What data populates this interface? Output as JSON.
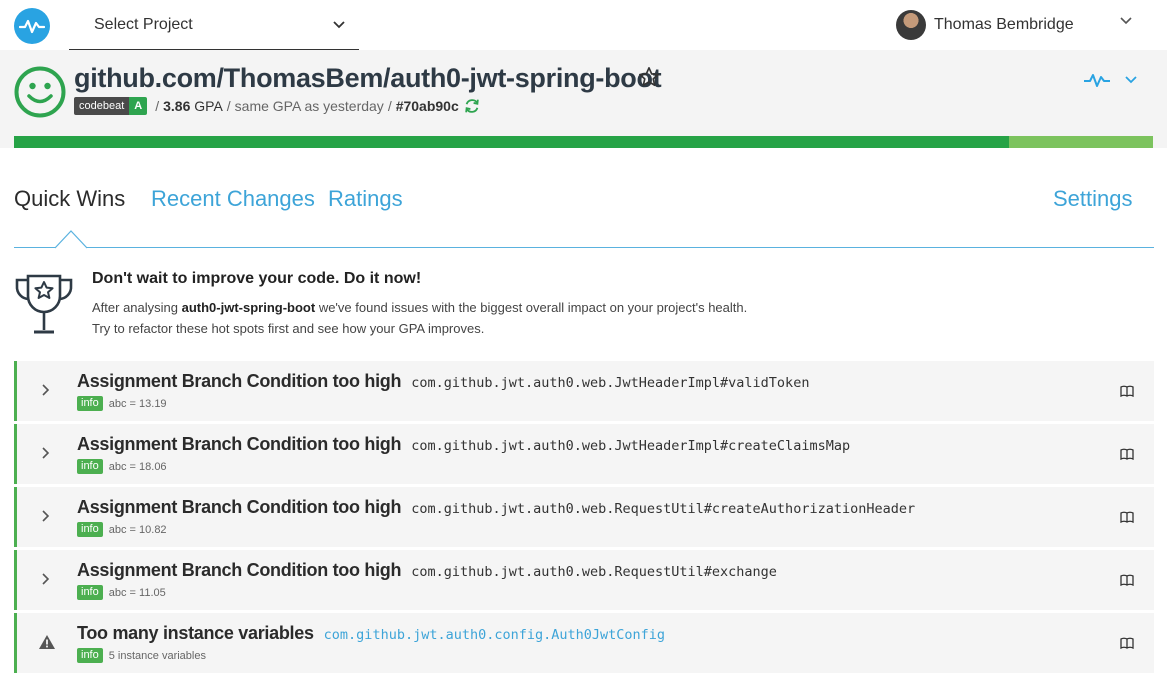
{
  "topbar": {
    "project_select_label": "Select Project",
    "user_name": "Thomas Bembridge"
  },
  "header": {
    "repo_title": "github.com/ThomasBem/auth0-jwt-spring-boot",
    "badge_label": "codebeat",
    "badge_grade": "A",
    "gpa_value": "3.86",
    "gpa_unit": "GPA",
    "gpa_note": "same GPA as yesterday",
    "commit": "#70ab90c",
    "progress_fraction": 0.874
  },
  "tabs": {
    "quick_wins": "Quick Wins",
    "recent_changes": "Recent Changes",
    "ratings": "Ratings",
    "settings": "Settings"
  },
  "intro": {
    "title": "Don't wait to improve your code. Do it now!",
    "line1_prefix": "After analysing ",
    "line1_repo": "auth0-jwt-spring-boot",
    "line1_suffix": " we've found issues with the biggest overall impact on your project's health.",
    "line2": "Try to refactor these hot spots first and see how your GPA improves."
  },
  "issues": [
    {
      "title": "Assignment Branch Condition too high",
      "path": "com.github.jwt.auth0.web.JwtHeaderImpl#validToken",
      "tag": "info",
      "detail": "abc = 13.19",
      "icon": "chevron-right-icon"
    },
    {
      "title": "Assignment Branch Condition too high",
      "path": "com.github.jwt.auth0.web.JwtHeaderImpl#createClaimsMap",
      "tag": "info",
      "detail": "abc = 18.06",
      "icon": "chevron-right-icon"
    },
    {
      "title": "Assignment Branch Condition too high",
      "path": "com.github.jwt.auth0.web.RequestUtil#createAuthorizationHeader",
      "tag": "info",
      "detail": "abc = 10.82",
      "icon": "chevron-right-icon"
    },
    {
      "title": "Assignment Branch Condition too high",
      "path": "com.github.jwt.auth0.web.RequestUtil#exchange",
      "tag": "info",
      "detail": "abc = 11.05",
      "icon": "chevron-right-icon"
    },
    {
      "title": "Too many instance variables",
      "path": "com.github.jwt.auth0.config.Auth0JwtConfig",
      "tag": "info",
      "detail": "5 instance variables",
      "icon": "warning-icon"
    }
  ],
  "colors": {
    "brand_blue": "#29a3e2",
    "link_blue": "#3da4d8",
    "grade_green": "#2ea44f",
    "progress_green": "#26a346",
    "progress_light": "#7cc35e"
  }
}
